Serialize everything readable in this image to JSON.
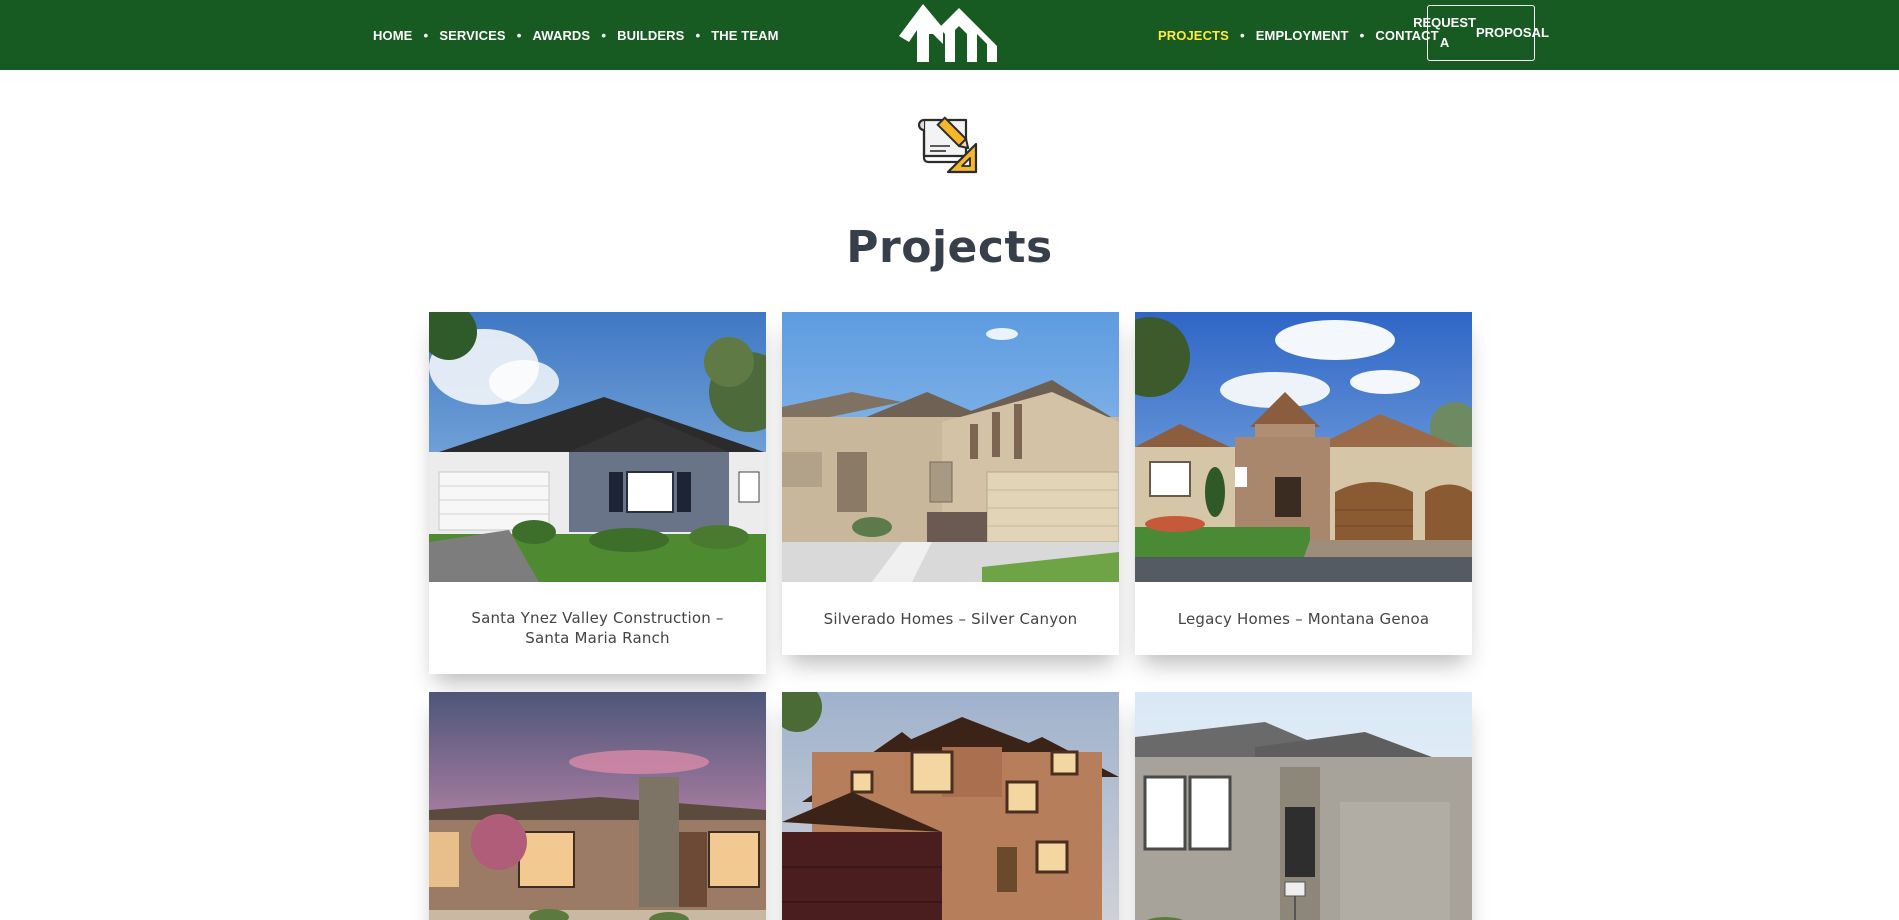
{
  "header": {
    "nav_left": [
      "HOME",
      "SERVICES",
      "AWARDS",
      "BUILDERS",
      "THE TEAM"
    ],
    "nav_right": [
      "PROJECTS",
      "EMPLOYMENT",
      "CONTACT"
    ],
    "active_item": "PROJECTS",
    "proposal_button": "REQUEST A PROPOSAL",
    "logo_icon": "tm-logo-icon",
    "bar_color": "#175a22",
    "active_color": "#ffeb3b"
  },
  "hero": {
    "icon": "blueprint-pencil-ruler-icon",
    "title": "Projects"
  },
  "projects": [
    {
      "caption": "Santa Ynez Valley Construction – Santa Maria Ranch"
    },
    {
      "caption": "Silverado Homes – Silver Canyon"
    },
    {
      "caption": "Legacy Homes – Montana Genoa"
    },
    {
      "caption": ""
    },
    {
      "caption": ""
    },
    {
      "caption": ""
    }
  ]
}
